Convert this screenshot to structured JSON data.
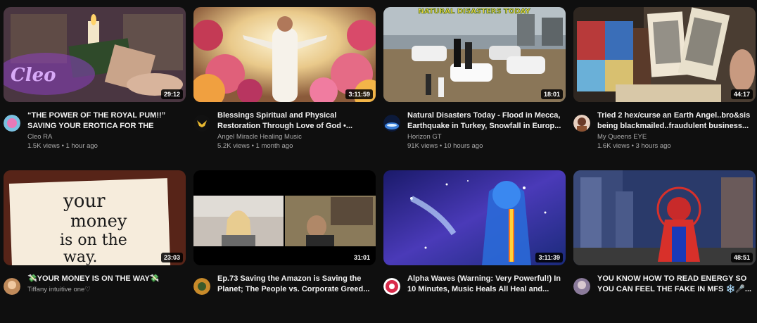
{
  "videos": [
    {
      "title": "“THE POWER OF THE ROYAL PUM!!” SAVING YOUR EROTICA FOR THE *BEST...",
      "channel": "Cleo RA",
      "stats": "1.5K views • 1 hour ago",
      "duration": "29:12",
      "thumb_text": "Cleo"
    },
    {
      "title": "Blessings Spiritual and Physical Restoration Through Love of God •...",
      "channel": "Angel Miracle Healing Music",
      "stats": "5.2K views • 1 month ago",
      "duration": "3:11:59"
    },
    {
      "title": "Natural Disasters Today - Flood in Mecca, Earthquake in Turkey, Snowfall in Europ...",
      "channel": "Horizon GT",
      "stats": "91K views • 10 hours ago",
      "duration": "18:01",
      "thumb_text": "NATURAL DISASTERS TODAY"
    },
    {
      "title": "Tried 2 hex/curse an Earth Angel..bro&sis being blackmailed..fraudulent business...",
      "channel": "My Queens EYE",
      "stats": "1.6K views • 3 hours ago",
      "duration": "44:17"
    },
    {
      "title": "💸YOUR MONEY IS ON THE WAY💸",
      "channel": "Tiffany intuitive one♡",
      "stats": "",
      "duration": "23:03",
      "thumb_text": [
        "your",
        "money",
        "is on the",
        "way."
      ]
    },
    {
      "title": "Ep.73 Saving the Amazon is Saving the Planet; The People vs. Corporate Greed...",
      "channel": "",
      "stats": "",
      "duration": "31:01"
    },
    {
      "title": "Alpha Waves (Warning: Very Powerful!) In 10 Minutes, Music Heals All Heal and...",
      "channel": "",
      "stats": "",
      "duration": "3:11:39"
    },
    {
      "title": "YOU KNOW HOW TO READ ENERGY SO YOU CAN FEEL THE FAKE IN MFS ❄️🎤...",
      "channel": "",
      "stats": "",
      "duration": "48:51"
    }
  ]
}
